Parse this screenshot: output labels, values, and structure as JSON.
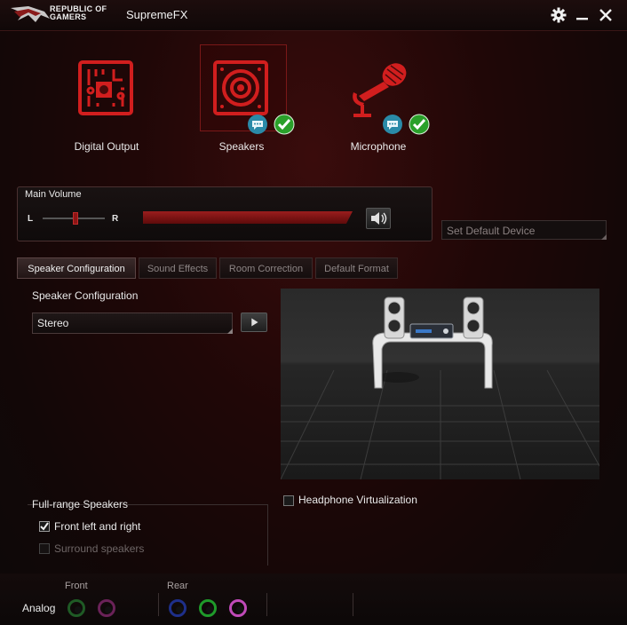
{
  "app": {
    "brand_line1": "REPUBLIC OF",
    "brand_line2": "GAMERS",
    "title": "SupremeFX"
  },
  "window_controls": {
    "settings_icon": "gear-icon",
    "minimize_icon": "minimize-icon",
    "close_icon": "close-icon"
  },
  "devices": [
    {
      "label": "Digital Output",
      "icon": "digital-output-icon",
      "selected": false
    },
    {
      "label": "Speakers",
      "icon": "speaker-icon",
      "selected": true,
      "badges": [
        "chat-icon",
        "check-icon"
      ]
    },
    {
      "label": "Microphone",
      "icon": "microphone-icon",
      "selected": false,
      "badges": [
        "chat-icon",
        "check-icon"
      ]
    }
  ],
  "volume": {
    "title": "Main Volume",
    "left_label": "L",
    "right_label": "R",
    "level": 0.97,
    "balance": 0.5,
    "mute_icon": "speaker-volume-icon"
  },
  "set_default_device": "Set Default Device",
  "tabs": [
    {
      "label": "Speaker Configuration",
      "active": true
    },
    {
      "label": "Sound Effects",
      "active": false
    },
    {
      "label": "Room Correction",
      "active": false
    },
    {
      "label": "Default Format",
      "active": false
    }
  ],
  "speaker_config": {
    "label": "Speaker Configuration",
    "selected": "Stereo",
    "play_icon": "play-icon"
  },
  "full_range": {
    "title": "Full-range Speakers",
    "options": [
      {
        "label": "Front left and right",
        "checked": true,
        "enabled": true
      },
      {
        "label": "Surround speakers",
        "checked": false,
        "enabled": false
      }
    ]
  },
  "headphone_virtualization": {
    "label": "Headphone Virtualization",
    "checked": false
  },
  "analog": {
    "label": "Analog",
    "front_label": "Front",
    "rear_label": "Rear",
    "front_jacks": [
      "#1f7a2a",
      "#8a2a6e"
    ],
    "rear_jacks": [
      "#1e2f8a",
      "#1f9a2a",
      "#c04ab8"
    ]
  },
  "colors": {
    "accent": "#c41e1e",
    "check_green": "#2aa02a",
    "chat_blue": "#2a8aa8"
  }
}
